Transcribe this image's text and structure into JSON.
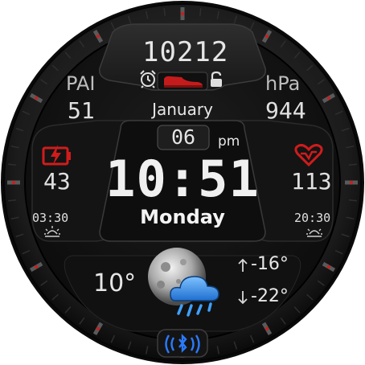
{
  "watch": {
    "steps": "10212",
    "pai_label": "PAI",
    "pai_value": "51",
    "pressure_label": "hPa",
    "pressure_value": "944",
    "month": "January",
    "day": "06",
    "ampm": "pm",
    "time": "10:51",
    "weekday": "Monday",
    "battery_value": "43",
    "heart_rate": "113",
    "sunrise": "03:30",
    "sunset": "20:30",
    "temperature": "10°",
    "temp_high": "-16°",
    "temp_low": "-22°"
  },
  "icons": {
    "alarm": "alarm-clock-icon",
    "shoe": "shoe-icon",
    "lock": "lock-icon",
    "battery": "battery-charging-icon",
    "heart": "heart-icon",
    "sunrise": "sunrise-icon",
    "sunset": "sunset-icon",
    "weather": "moon-cloud-rain-icon",
    "bluetooth": "bluetooth-icon",
    "arrow_up": "arrow-up-icon",
    "arrow_down": "arrow-down-icon"
  },
  "colors": {
    "accent_red": "#d01c1c",
    "bluetooth_blue": "#2a7bff",
    "weather_blue": "#2f8fe8"
  }
}
